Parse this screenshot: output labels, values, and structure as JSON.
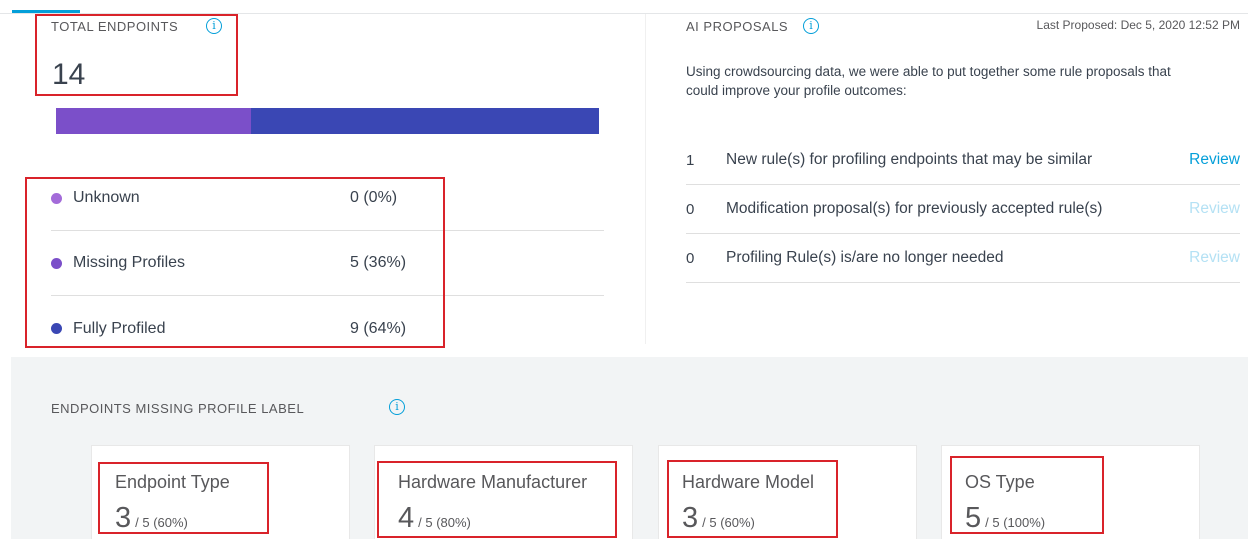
{
  "total_endpoints": {
    "label": "TOTAL ENDPOINTS",
    "value": "14",
    "info_icon": "info-icon"
  },
  "distribution_bar": [
    {
      "name": "Missing Profiles",
      "fraction": 0.36,
      "color": "#7b4fc9"
    },
    {
      "name": "Fully Profiled",
      "fraction": 0.64,
      "color": "#3a47b4"
    }
  ],
  "legend": [
    {
      "label": "Unknown",
      "value": "0 (0%)",
      "color": "#a36bd9"
    },
    {
      "label": "Missing Profiles",
      "value": "5 (36%)",
      "color": "#7b4fc9"
    },
    {
      "label": "Fully Profiled",
      "value": "9 (64%)",
      "color": "#3a47b4"
    }
  ],
  "ai_proposals": {
    "label": "AI PROPOSALS",
    "info_icon": "info-icon",
    "last_proposed": "Last Proposed: Dec 5, 2020 12:52 PM",
    "description": "Using crowdsourcing data, we were able to put together some rule proposals that could improve your profile outcomes:",
    "items": [
      {
        "count": "1",
        "text": "New rule(s) for profiling endpoints that may be similar",
        "action": "Review",
        "enabled": true
      },
      {
        "count": "0",
        "text": "Modification proposal(s) for previously accepted rule(s)",
        "action": "Review",
        "enabled": false
      },
      {
        "count": "0",
        "text": "Profiling Rule(s) is/are no longer needed",
        "action": "Review",
        "enabled": false
      }
    ]
  },
  "missing_profile": {
    "label": "ENDPOINTS MISSING PROFILE LABEL",
    "info_icon": "info-icon",
    "cards": [
      {
        "title": "Endpoint Type",
        "value": "3",
        "of": "/ 5 (60%)"
      },
      {
        "title": "Hardware Manufacturer",
        "value": "4",
        "of": "/ 5 (80%)"
      },
      {
        "title": "Hardware Model",
        "value": "3",
        "of": "/ 5 (60%)"
      },
      {
        "title": "OS Type",
        "value": "5",
        "of": "/ 5 (100%)"
      }
    ]
  },
  "colors": {
    "accent": "#049fd9",
    "highlight": "#d9232a",
    "review_disabled": "#b4e1f4"
  }
}
